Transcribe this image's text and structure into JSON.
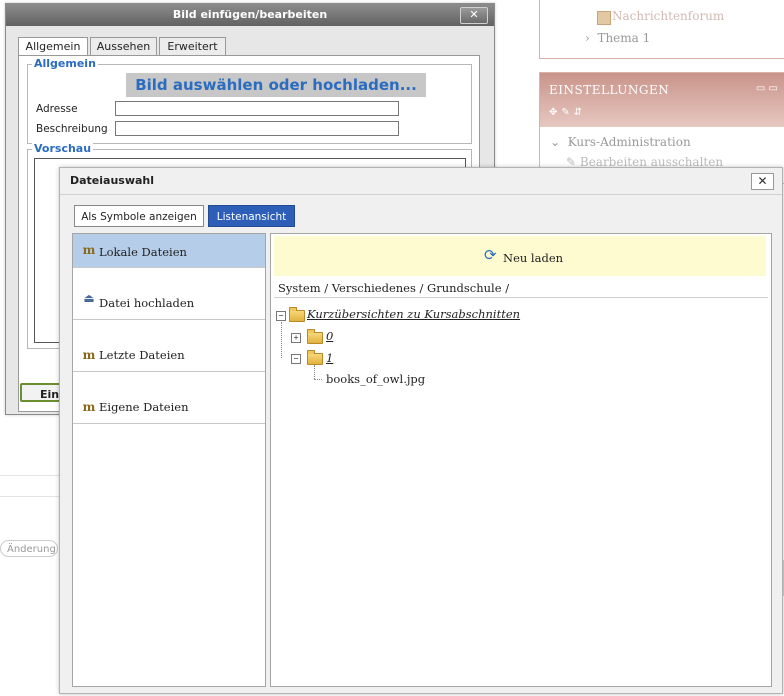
{
  "background": {
    "forum_label": "Nachrichtenforum",
    "thema_label": "Thema 1",
    "settings_title": "EINSTELLUNGEN",
    "kurs_admin": "Kurs-Administration",
    "bearbeiten": "Bearbeiten ausschalten",
    "left_button": "Änderung"
  },
  "image_dialog": {
    "title": "Bild einfügen/bearbeiten",
    "tabs": [
      {
        "label": "Allgemein",
        "active": true
      },
      {
        "label": "Aussehen",
        "active": false
      },
      {
        "label": "Erweitert",
        "active": false
      }
    ],
    "general_legend": "Allgemein",
    "pick_button": "Bild auswählen oder hochladen...",
    "address_label": "Adresse",
    "address_value": "",
    "description_label": "Beschreibung",
    "description_value": "",
    "preview_legend": "Vorschau",
    "insert_button": "Ein"
  },
  "file_picker": {
    "title": "Dateiauswahl",
    "view_buttons": [
      {
        "label": "Als Symbole anzeigen",
        "active": false
      },
      {
        "label": "Listenansicht",
        "active": true
      }
    ],
    "repositories": [
      {
        "label": "Lokale Dateien",
        "icon": "book-icon",
        "selected": true
      },
      {
        "label": "Datei hochladen",
        "icon": "upload-icon",
        "selected": false
      },
      {
        "label": "Letzte Dateien",
        "icon": "book-icon",
        "selected": false
      },
      {
        "label": "Eigene Dateien",
        "icon": "book-icon",
        "selected": false
      }
    ],
    "reload_label": "Neu laden",
    "breadcrumb": "System / Verschiedenes / Grundschule /",
    "tree": {
      "root": "Kurzübersichten zu Kursabschnitten",
      "folders": [
        "0",
        "1"
      ],
      "file": "books_of_owl.jpg"
    },
    "colors": {
      "accent": "#2d5fb8",
      "reload_bg": "#fdfbcf",
      "selected_bg": "#b6cdea"
    }
  }
}
